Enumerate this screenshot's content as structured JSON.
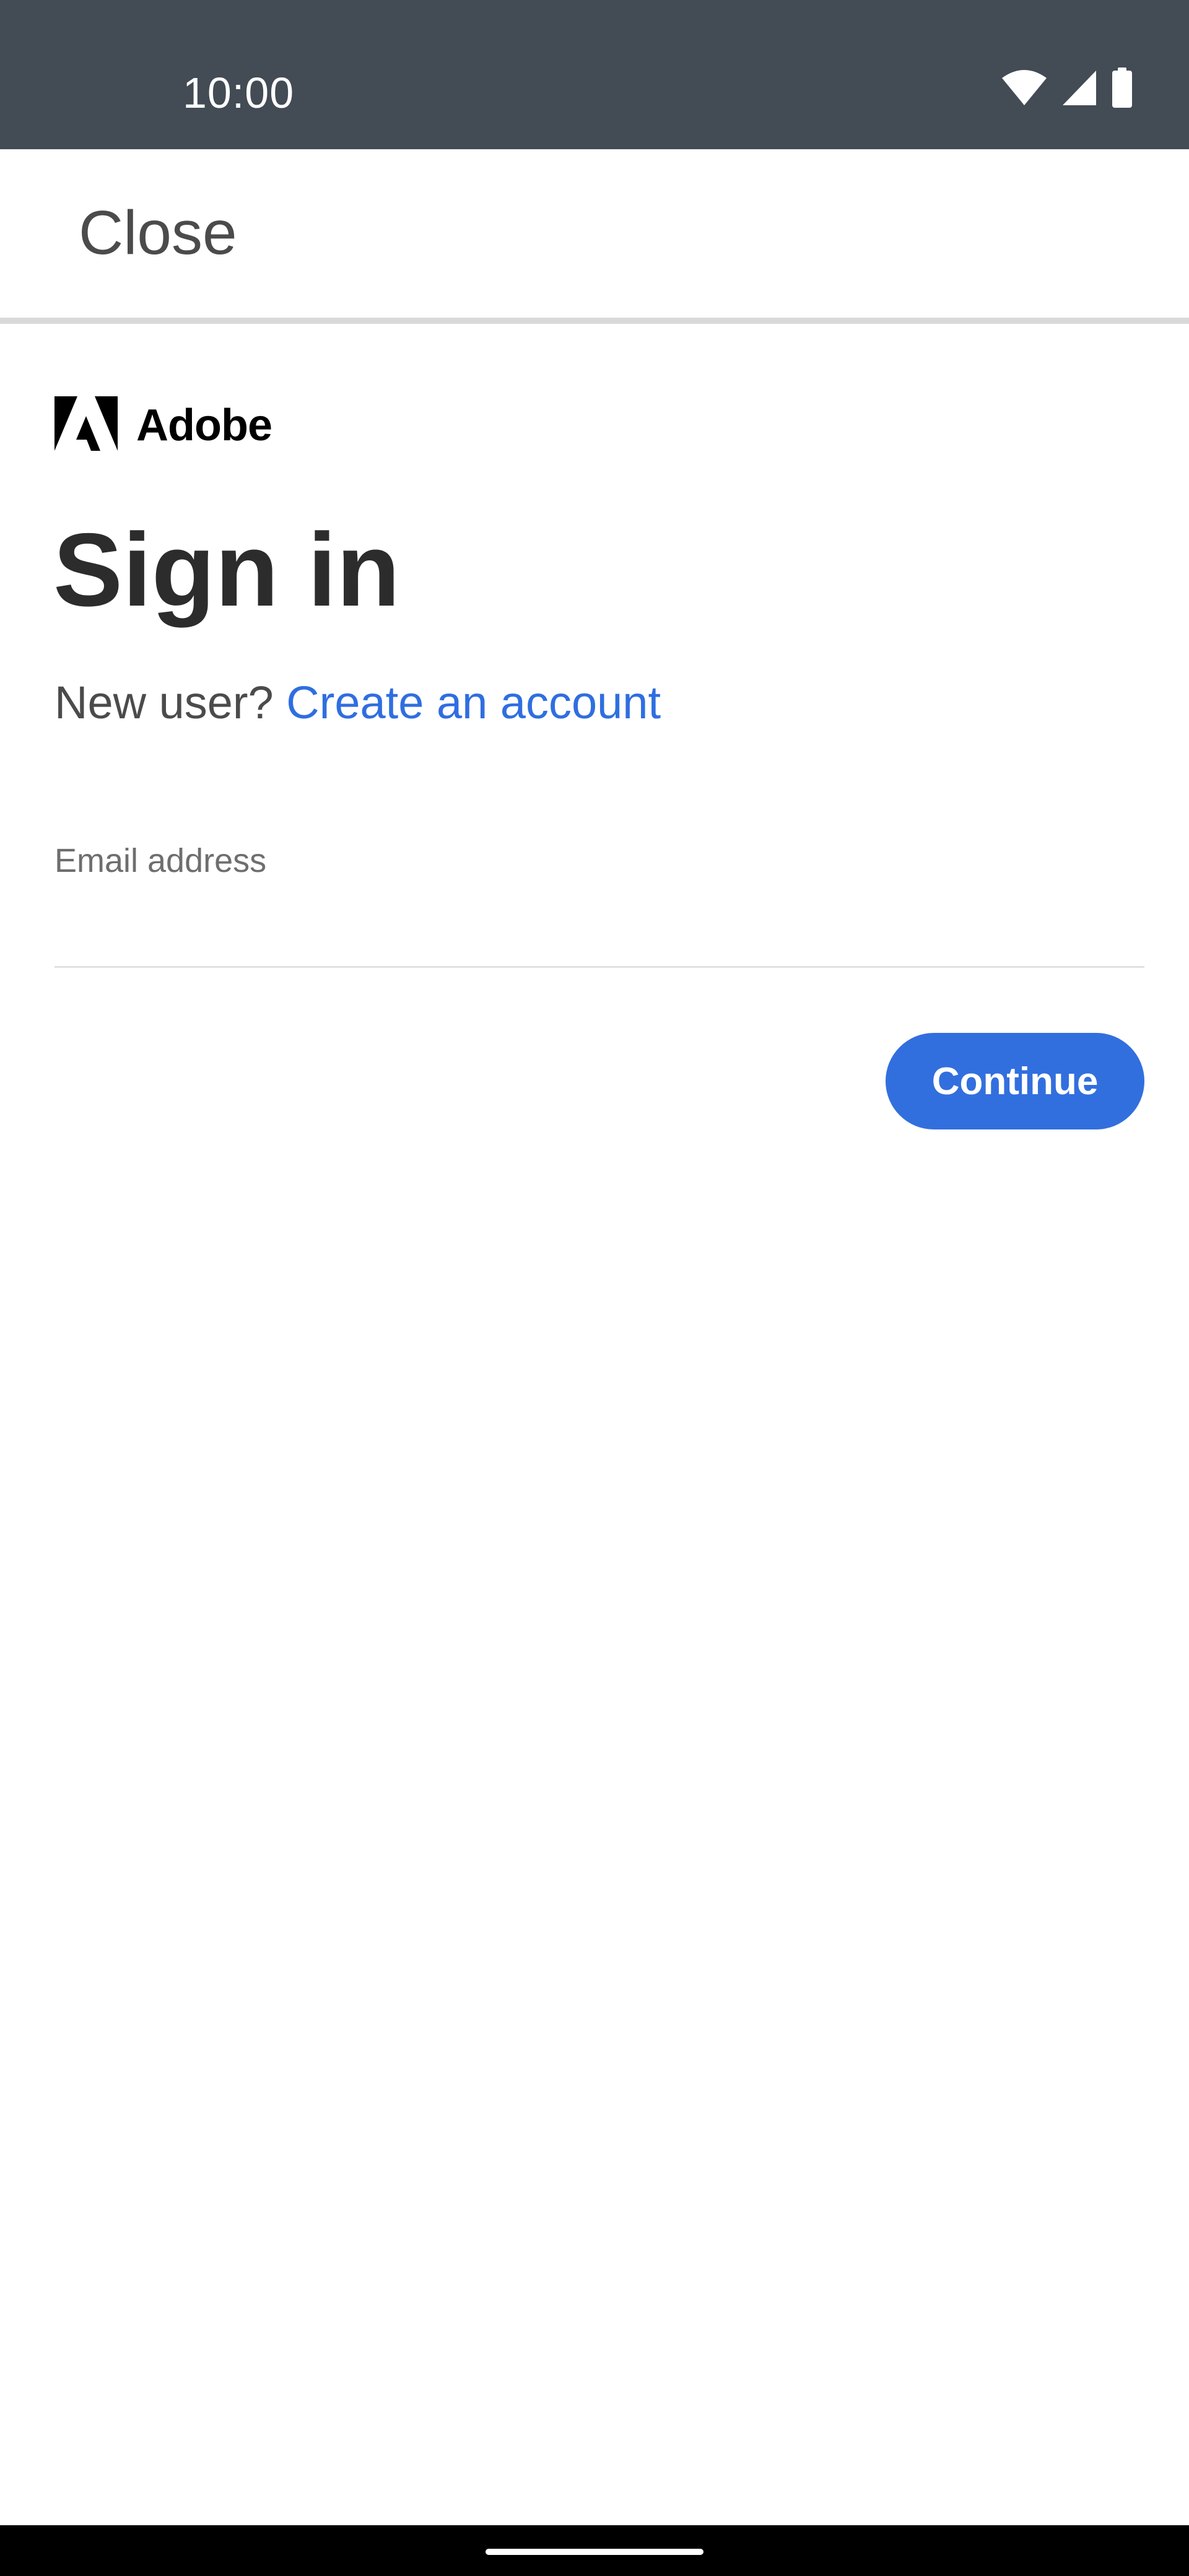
{
  "status_bar": {
    "time": "10:00",
    "icons": [
      "wifi-icon",
      "cell-signal-icon",
      "battery-icon"
    ],
    "background": "#434b55"
  },
  "top_bar": {
    "close_label": "Close"
  },
  "brand": {
    "name": "Adobe",
    "logo_icon": "adobe-logo-icon"
  },
  "signin": {
    "title": "Sign in",
    "new_user_prompt": "New user?",
    "create_account_link": "Create an account",
    "email_label": "Email address",
    "email_value": "",
    "continue_label": "Continue"
  },
  "colors": {
    "accent": "#326fde",
    "link": "#2f6ee0",
    "title_text": "#2c2c2c"
  }
}
